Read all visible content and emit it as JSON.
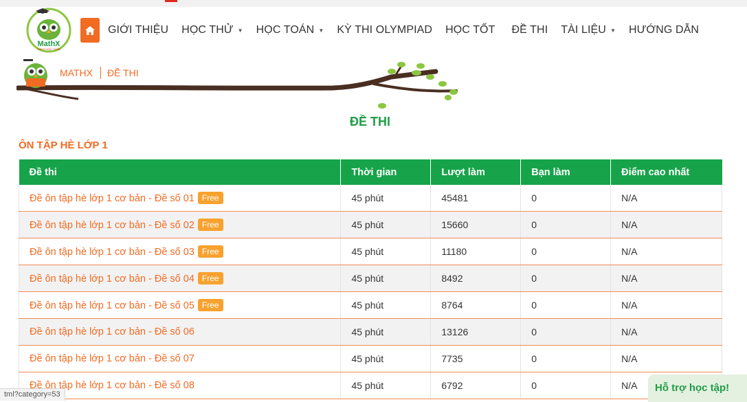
{
  "logo": {
    "name": "MathX",
    "tagline": "THÍCH HỌC TOÁN"
  },
  "nav": {
    "items": [
      {
        "label": "GIỚI THIỆU",
        "dropdown": false
      },
      {
        "label": "HỌC THỬ",
        "dropdown": true
      },
      {
        "label": "HỌC TOÁN",
        "dropdown": true
      },
      {
        "label": "KỲ THI OLYMPIAD",
        "dropdown": false
      },
      {
        "label": "HỌC TỐT",
        "dropdown": false
      },
      {
        "label": "ĐỀ THI",
        "dropdown": false
      },
      {
        "label": "TÀI LIỆU",
        "dropdown": true
      },
      {
        "label": "HƯỚNG DẪN",
        "dropdown": false
      }
    ]
  },
  "breadcrumb": {
    "home": "MATHX",
    "current": "ĐỀ THI"
  },
  "page_title": "ĐỀ THI",
  "section_title": "ÔN TẬP HÈ LỚP 1",
  "table": {
    "headers": [
      "Đề thi",
      "Thời gian",
      "Lượt làm",
      "Bạn làm",
      "Điểm cao nhất"
    ],
    "free_label": "Free",
    "rows": [
      {
        "name": "Đề ôn tập hè lớp 1 cơ bản - Đề số 01",
        "free": true,
        "time": "45 phút",
        "attempts": "45481",
        "you": "0",
        "best": "N/A"
      },
      {
        "name": "Đề ôn tập hè lớp 1 cơ bản - Đề số 02",
        "free": true,
        "time": "45 phút",
        "attempts": "15660",
        "you": "0",
        "best": "N/A"
      },
      {
        "name": "Đề ôn tập hè lớp 1 cơ bản - Đề số 03",
        "free": true,
        "time": "45 phút",
        "attempts": "11180",
        "you": "0",
        "best": "N/A"
      },
      {
        "name": "Đề ôn tập hè lớp 1 cơ bản - Đề số 04",
        "free": true,
        "time": "45 phút",
        "attempts": "8492",
        "you": "0",
        "best": "N/A"
      },
      {
        "name": "Đề ôn tập hè lớp 1 cơ bản - Đề số 05",
        "free": true,
        "time": "45 phút",
        "attempts": "8764",
        "you": "0",
        "best": "N/A"
      },
      {
        "name": "Đề ôn tập hè lớp 1 cơ bản - Đề số 06",
        "free": false,
        "time": "45 phút",
        "attempts": "13126",
        "you": "0",
        "best": "N/A"
      },
      {
        "name": "Đề ôn tập hè lớp 1 cơ bản - Đề số 07",
        "free": false,
        "time": "45 phút",
        "attempts": "7735",
        "you": "0",
        "best": "N/A"
      },
      {
        "name": "Đề ôn tập hè lớp 1 cơ bản - Đề số 08",
        "free": false,
        "time": "45 phút",
        "attempts": "6792",
        "you": "0",
        "best": "N/A"
      }
    ]
  },
  "status_bar_url": "tml?category=53",
  "help_widget": "Hỗ trợ học tập!",
  "colors": {
    "brand_orange": "#f26b22",
    "brand_green": "#17a34a",
    "free_badge": "#f7a22f"
  }
}
